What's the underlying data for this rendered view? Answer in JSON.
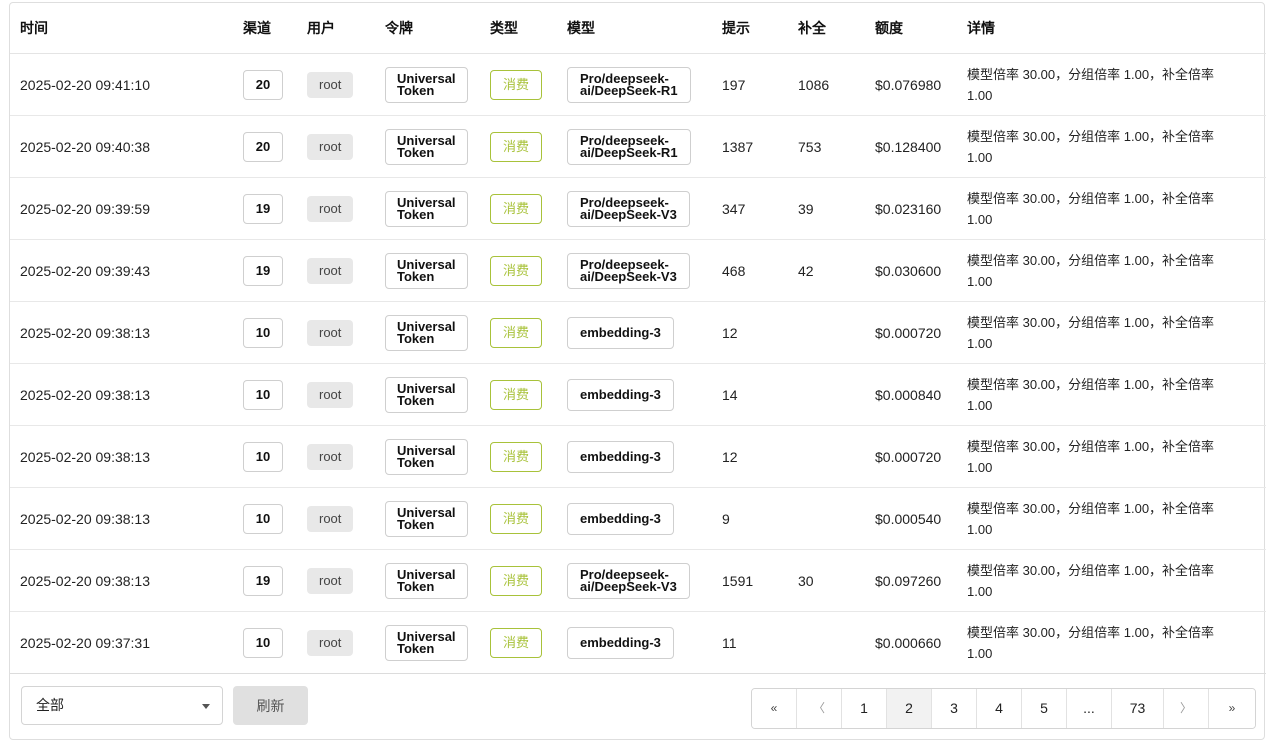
{
  "columns": [
    "时间",
    "渠道",
    "用户",
    "令牌",
    "类型",
    "模型",
    "提示",
    "补全",
    "额度",
    "详情"
  ],
  "rows": [
    {
      "time": "2025-02-20 09:41:10",
      "channel": "20",
      "user": "root",
      "token_l1": "Universal",
      "token_l2": "Token",
      "type": "消费",
      "model_l1": "Pro/deepseek-",
      "model_l2": "ai/DeepSeek-R1",
      "prompt": "197",
      "completion": "1086",
      "quota": "$0.076980",
      "detail_l1": "模型倍率 30.00，分组倍率 1.00，补全倍率",
      "detail_l2": "1.00"
    },
    {
      "time": "2025-02-20 09:40:38",
      "channel": "20",
      "user": "root",
      "token_l1": "Universal",
      "token_l2": "Token",
      "type": "消费",
      "model_l1": "Pro/deepseek-",
      "model_l2": "ai/DeepSeek-R1",
      "prompt": "1387",
      "completion": "753",
      "quota": "$0.128400",
      "detail_l1": "模型倍率 30.00，分组倍率 1.00，补全倍率",
      "detail_l2": "1.00"
    },
    {
      "time": "2025-02-20 09:39:59",
      "channel": "19",
      "user": "root",
      "token_l1": "Universal",
      "token_l2": "Token",
      "type": "消费",
      "model_l1": "Pro/deepseek-",
      "model_l2": "ai/DeepSeek-V3",
      "prompt": "347",
      "completion": "39",
      "quota": "$0.023160",
      "detail_l1": "模型倍率 30.00，分组倍率 1.00，补全倍率",
      "detail_l2": "1.00"
    },
    {
      "time": "2025-02-20 09:39:43",
      "channel": "19",
      "user": "root",
      "token_l1": "Universal",
      "token_l2": "Token",
      "type": "消费",
      "model_l1": "Pro/deepseek-",
      "model_l2": "ai/DeepSeek-V3",
      "prompt": "468",
      "completion": "42",
      "quota": "$0.030600",
      "detail_l1": "模型倍率 30.00，分组倍率 1.00，补全倍率",
      "detail_l2": "1.00"
    },
    {
      "time": "2025-02-20 09:38:13",
      "channel": "10",
      "user": "root",
      "token_l1": "Universal",
      "token_l2": "Token",
      "type": "消费",
      "model_l1": "embedding-3",
      "model_l2": "",
      "prompt": "12",
      "completion": "",
      "quota": "$0.000720",
      "detail_l1": "模型倍率 30.00，分组倍率 1.00，补全倍率",
      "detail_l2": "1.00"
    },
    {
      "time": "2025-02-20 09:38:13",
      "channel": "10",
      "user": "root",
      "token_l1": "Universal",
      "token_l2": "Token",
      "type": "消费",
      "model_l1": "embedding-3",
      "model_l2": "",
      "prompt": "14",
      "completion": "",
      "quota": "$0.000840",
      "detail_l1": "模型倍率 30.00，分组倍率 1.00，补全倍率",
      "detail_l2": "1.00"
    },
    {
      "time": "2025-02-20 09:38:13",
      "channel": "10",
      "user": "root",
      "token_l1": "Universal",
      "token_l2": "Token",
      "type": "消费",
      "model_l1": "embedding-3",
      "model_l2": "",
      "prompt": "12",
      "completion": "",
      "quota": "$0.000720",
      "detail_l1": "模型倍率 30.00，分组倍率 1.00，补全倍率",
      "detail_l2": "1.00"
    },
    {
      "time": "2025-02-20 09:38:13",
      "channel": "10",
      "user": "root",
      "token_l1": "Universal",
      "token_l2": "Token",
      "type": "消费",
      "model_l1": "embedding-3",
      "model_l2": "",
      "prompt": "9",
      "completion": "",
      "quota": "$0.000540",
      "detail_l1": "模型倍率 30.00，分组倍率 1.00，补全倍率",
      "detail_l2": "1.00"
    },
    {
      "time": "2025-02-20 09:38:13",
      "channel": "19",
      "user": "root",
      "token_l1": "Universal",
      "token_l2": "Token",
      "type": "消费",
      "model_l1": "Pro/deepseek-",
      "model_l2": "ai/DeepSeek-V3",
      "prompt": "1591",
      "completion": "30",
      "quota": "$0.097260",
      "detail_l1": "模型倍率 30.00，分组倍率 1.00，补全倍率",
      "detail_l2": "1.00"
    },
    {
      "time": "2025-02-20 09:37:31",
      "channel": "10",
      "user": "root",
      "token_l1": "Universal",
      "token_l2": "Token",
      "type": "消费",
      "model_l1": "embedding-3",
      "model_l2": "",
      "prompt": "11",
      "completion": "",
      "quota": "$0.000660",
      "detail_l1": "模型倍率 30.00，分组倍率 1.00，补全倍率",
      "detail_l2": "1.00"
    }
  ],
  "footer": {
    "filter_value": "全部",
    "refresh_label": "刷新"
  },
  "pagination": {
    "first": "«",
    "prev": "〈",
    "pages": [
      "1",
      "2",
      "3",
      "4",
      "5",
      "...",
      "73"
    ],
    "next": "〉",
    "last": "»",
    "active_page": "2"
  },
  "colors": {
    "type_badge": "#a8c23a",
    "user_badge_bg": "#e8e8e8",
    "refresh_bg": "#e0e0e0"
  }
}
